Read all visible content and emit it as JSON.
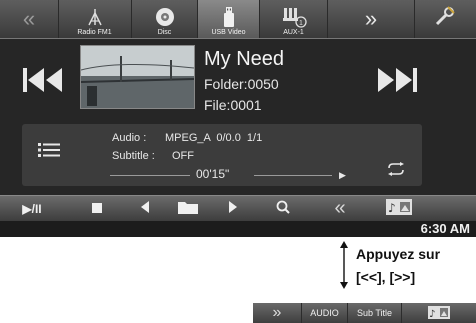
{
  "colors": {
    "screen_bg": "#262626",
    "bar": "#4a4a4a",
    "text": "#f0f0f0"
  },
  "topbar": {
    "prev_arrow_icon": "double-chevron-left",
    "sources": [
      {
        "label": "Radio FM1",
        "icon": "antenna-icon"
      },
      {
        "label": "Disc",
        "icon": "disc-icon"
      },
      {
        "label": "USB Video",
        "icon": "usb-icon",
        "active": true
      },
      {
        "label": "AUX-1",
        "icon": "aux-icon"
      }
    ],
    "next_arrow_icon": "double-chevron-right",
    "setup_icon": "wrench-icon"
  },
  "now_playing": {
    "title": "My Need",
    "folder": "Folder:0050",
    "file": "File:0001"
  },
  "info": {
    "audio_label": "Audio :",
    "audio_value": "MPEG_A  0/0.0  1/1",
    "subtitle_label": "Subtitle :",
    "subtitle_value": "OFF",
    "elapsed": "00'15\""
  },
  "controls": {
    "play_pause": "▶/II",
    "clock": "6:30 AM"
  },
  "annotation": {
    "line1": "Appuyez sur",
    "line2": "[<<], [>>]"
  },
  "mini_bar": {
    "audio": "AUDIO",
    "subtitle": "Sub Title"
  }
}
